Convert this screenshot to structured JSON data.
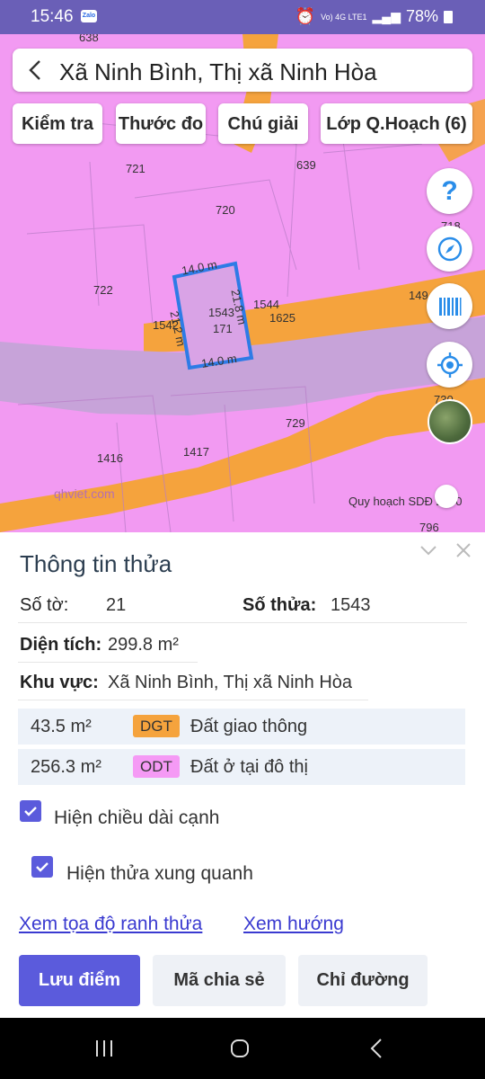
{
  "status": {
    "time": "15:46",
    "zalo": "Zalo",
    "network": "Vo) 4G LTE1",
    "battery": "78%"
  },
  "header": {
    "title": "Xã Ninh Bình, Thị xã Ninh Hòa"
  },
  "chips": [
    "Kiểm tra",
    "Thước đo",
    "Chú giải",
    "Lớp Q.Hoạch (6)"
  ],
  "fabs": [
    "help-icon",
    "compass-icon",
    "barcode-icon",
    "locate-icon",
    "satellite-layer"
  ],
  "map": {
    "parcels": [
      "638",
      "721",
      "720",
      "639",
      "722",
      "1542",
      "1543",
      "171",
      "1544",
      "1625",
      "149",
      "718",
      "730",
      "729",
      "1416",
      "1417",
      "796"
    ],
    "edges": {
      "top": "14.0 m",
      "right": "21.8 m",
      "left": "21.2 m",
      "bottom": "14.0 m"
    },
    "watermark": "qhviet.com",
    "layer_label": "Quy hoạch SDĐ 2030"
  },
  "panel": {
    "title": "Thông tin thửa",
    "so_to_label": "Số tờ:",
    "so_to": "21",
    "so_thua_label": "Số thửa:",
    "so_thua": "1543",
    "dien_tich_label": "Diện tích:",
    "dien_tich": "299.8 m²",
    "khu_vuc_label": "Khu vực:",
    "khu_vuc": "Xã Ninh Bình, Thị xã Ninh Hòa",
    "zones": [
      {
        "area": "43.5 m²",
        "code": "DGT",
        "desc": "Đất giao thông",
        "color": "#f5a33d"
      },
      {
        "area": "256.3 m²",
        "code": "ODT",
        "desc": "Đất ở tại đô thị",
        "color": "#f59af5"
      }
    ],
    "checkbox_edges": "Hiện chiều dài cạnh",
    "checkbox_neighbors": "Hiện thửa xung quanh",
    "link_coords": "Xem tọa độ ranh thửa",
    "link_direction": "Xem hướng",
    "btn_save": "Lưu điểm",
    "btn_share": "Mã chia sẻ",
    "btn_route": "Chỉ đường"
  }
}
